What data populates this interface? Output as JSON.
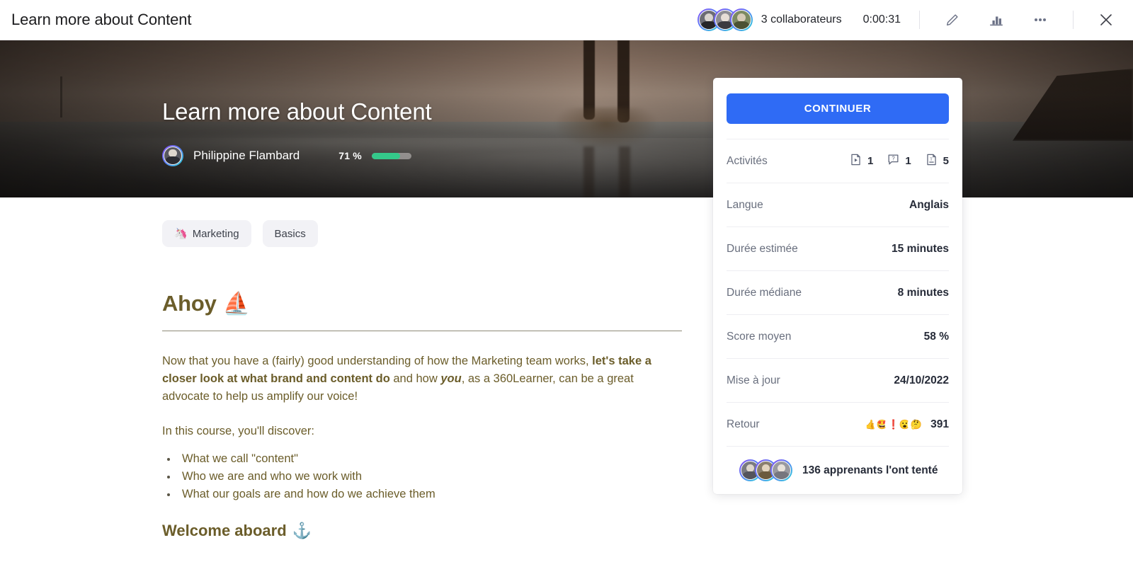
{
  "topbar": {
    "title": "Learn more about Content",
    "collaborators_label": "3 collaborateurs",
    "timer": "0:00:31",
    "edit_icon": "pencil-icon",
    "stats_icon": "bar-chart-icon",
    "more_icon": "ellipsis-icon",
    "close_icon": "close-icon"
  },
  "hero": {
    "title": "Learn more about Content",
    "author": "Philippine Flambard",
    "progress_pct_label": "71 %",
    "progress_pct": 71,
    "progress_color": "#34c98a"
  },
  "tags": [
    {
      "emoji": "🦄",
      "label": "Marketing"
    },
    {
      "emoji": "",
      "label": "Basics"
    }
  ],
  "article": {
    "heading": "Ahoy",
    "heading_emoji": "⛵",
    "paragraph_1": {
      "part_1": "Now that you have a (fairly) good understanding of how the Marketing team works, ",
      "bold_1": "let's take a closer look at what brand and content do",
      "part_2": " and how ",
      "italic_1": "you",
      "part_3": ", as a 360Learner, can be a great advocate to help us amplify our voice!"
    },
    "paragraph_2": "In this course, you'll discover:",
    "bullets": [
      "What we call \"content\"",
      "Who we are and who we work with",
      "What our goals are and how do we achieve them"
    ],
    "heading_2": "Welcome aboard",
    "heading_2_emoji": "⚓"
  },
  "card": {
    "continue_label": "CONTINUER",
    "activities": {
      "label": "Activités",
      "items": [
        {
          "icon": "video-document-icon",
          "count": "1"
        },
        {
          "icon": "question-bubble-icon",
          "count": "1"
        },
        {
          "icon": "text-document-icon",
          "count": "5"
        }
      ]
    },
    "rows": [
      {
        "label": "Langue",
        "value": "Anglais"
      },
      {
        "label": "Durée estimée",
        "value": "15 minutes"
      },
      {
        "label": "Durée médiane",
        "value": "8 minutes"
      },
      {
        "label": "Score moyen",
        "value": "58 %"
      },
      {
        "label": "Mise à jour",
        "value": "24/10/2022"
      }
    ],
    "feedback": {
      "label": "Retour",
      "reactions": [
        "👍",
        "🤩",
        "❗",
        "😮",
        "🤔"
      ],
      "count": "391"
    },
    "learners_label": "136 apprenants l'ont tenté",
    "accent_color": "#2f6bf5"
  }
}
